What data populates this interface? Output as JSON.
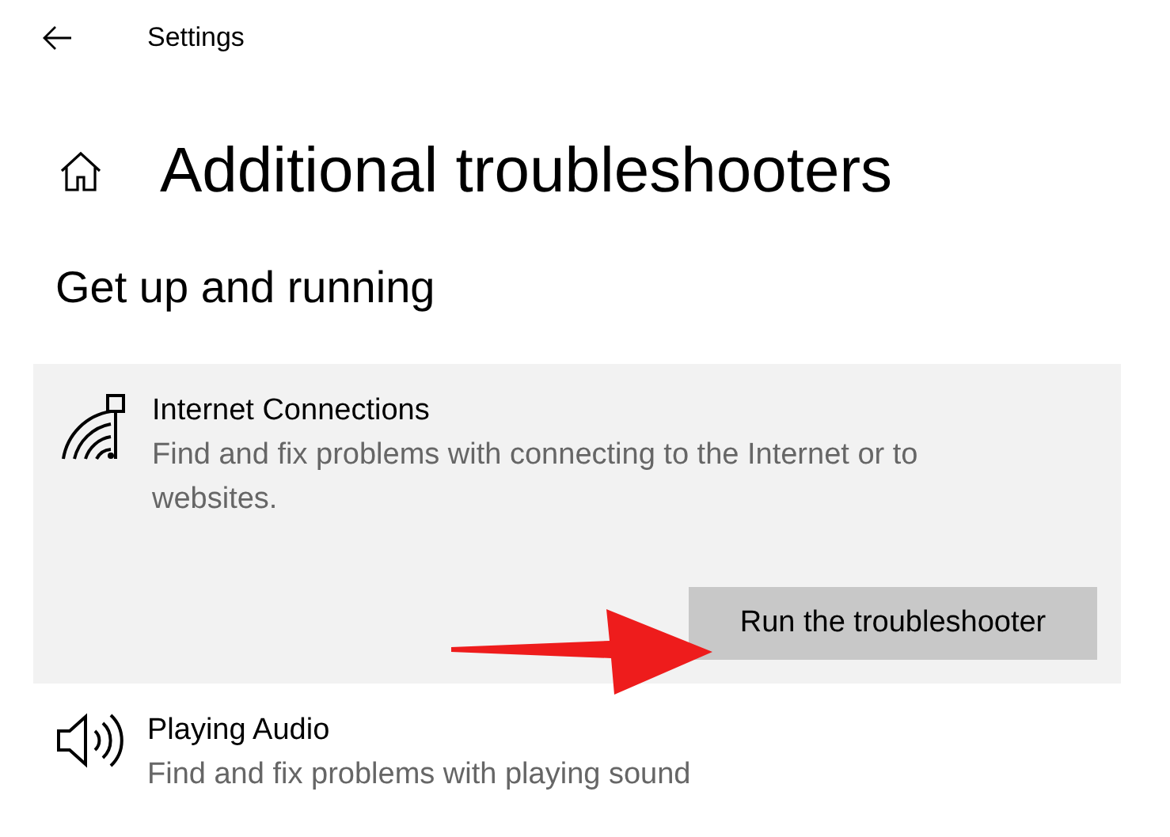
{
  "header": {
    "title": "Settings"
  },
  "page": {
    "title": "Additional troubleshooters"
  },
  "section": {
    "title": "Get up and running"
  },
  "troubleshooters": [
    {
      "kind": "network",
      "name": "Internet Connections",
      "description": "Find and fix problems with connecting to the Internet or to websites.",
      "expanded": true,
      "button": "Run the troubleshooter"
    },
    {
      "kind": "audio",
      "name": "Playing Audio",
      "description": "Find and fix problems with playing sound",
      "expanded": false
    }
  ]
}
